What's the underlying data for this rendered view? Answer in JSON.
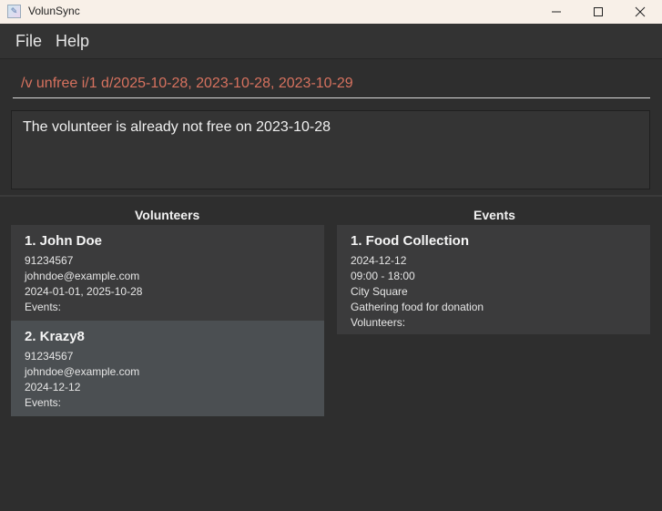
{
  "window": {
    "title": "VolunSync"
  },
  "menu": {
    "file": "File",
    "help": "Help"
  },
  "command": {
    "value": "/v unfree i/1 d/2025-10-28, 2023-10-28, 2023-10-29"
  },
  "result": {
    "text": "The volunteer is already not free on 2023-10-28"
  },
  "volunteers": {
    "heading": "Volunteers",
    "items": [
      {
        "title": "1. John Doe",
        "phone": "91234567",
        "email": "johndoe@example.com",
        "dates": "2024-01-01, 2025-10-28",
        "events": "Events:"
      },
      {
        "title": "2. Krazy8",
        "phone": "91234567",
        "email": "johndoe@example.com",
        "dates": "2024-12-12",
        "events": "Events:"
      }
    ]
  },
  "events": {
    "heading": "Events",
    "items": [
      {
        "title": "1. Food Collection",
        "date": "2024-12-12",
        "time": "09:00 - 18:00",
        "location": "City Square",
        "description": "Gathering food for donation",
        "volunteers": "Volunteers:"
      }
    ]
  }
}
